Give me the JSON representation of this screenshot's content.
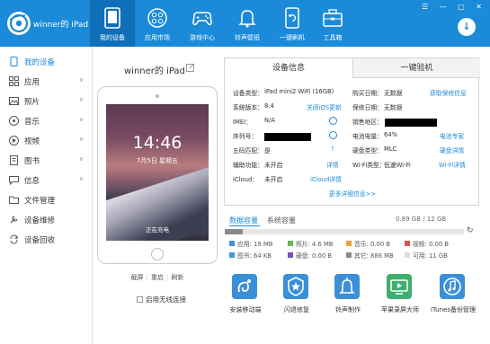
{
  "header": {
    "device_name": "winner的 iPad",
    "nav": [
      {
        "label": "我的设备",
        "icon": "tablet-icon",
        "active": true
      },
      {
        "label": "应用市场",
        "icon": "apps-grid-icon",
        "active": false
      },
      {
        "label": "游戏中心",
        "icon": "gamepad-icon",
        "active": false
      },
      {
        "label": "铃声壁纸",
        "icon": "bell-icon",
        "active": false
      },
      {
        "label": "一键刷机",
        "icon": "flash-phone-icon",
        "active": false
      },
      {
        "label": "工具箱",
        "icon": "toolbox-icon",
        "active": false
      }
    ],
    "window_controls": "☰ — □ ✕",
    "download_icon": "download-icon"
  },
  "sidebar": {
    "items": [
      {
        "label": "我的设备",
        "chevron": ""
      },
      {
        "label": "应用",
        "chevron": "∨"
      },
      {
        "label": "照片",
        "chevron": "∨"
      },
      {
        "label": "音乐",
        "chevron": "∨"
      },
      {
        "label": "视频",
        "chevron": "∨"
      },
      {
        "label": "图书",
        "chevron": "∨"
      },
      {
        "label": "信息",
        "chevron": "∨"
      },
      {
        "label": "文件管理",
        "chevron": ""
      },
      {
        "label": "设备维修",
        "chevron": ""
      },
      {
        "label": "设备回收",
        "chevron": ""
      }
    ]
  },
  "device": {
    "title": "winner的 iPad",
    "lock_time": "14:46",
    "lock_date": "7月5日 星期五",
    "charging": "正在充电",
    "actions": [
      "截屏",
      "重启",
      "刷新"
    ],
    "wireless_label": "启用无线连接"
  },
  "info": {
    "tab_active": "设备信息",
    "tab_other": "一键验机",
    "rows": [
      {
        "l1": "设备类型：",
        "v1": "iPad mini2 WiFi  (16GB)",
        "a1": "",
        "l2": "购买日期：",
        "v2": "无数据",
        "a2": "获取保修信息"
      },
      {
        "l1": "系统版本：",
        "v1": "8.4",
        "a1": "关闭iOS更新",
        "l2": "保修日期：",
        "v2": "无数据",
        "a2": ""
      },
      {
        "l1": "IMEI：",
        "v1": "N/A",
        "a1": "",
        "l2": "销售地区：",
        "v2": "",
        "a2": ""
      },
      {
        "l1": "序列号：",
        "v1": "",
        "a1": "",
        "l2": "电池电量：",
        "v2": "64%",
        "a2": "电池专家"
      },
      {
        "l1": "五码匹配：",
        "v1": "是",
        "a1": "?",
        "l2": "硬盘类型：",
        "v2": "MLC",
        "a2": "硬盘详情"
      },
      {
        "l1": "辅助功能：",
        "v1": "未开启",
        "a1": "详情",
        "l2": "Wi-Fi类型：",
        "v2": "低速Wi-Fi",
        "a2": "Wi-Fi详情"
      },
      {
        "l1": "iCloud：",
        "v1": "未开启",
        "a1": "iCloud详情",
        "l2": "",
        "v2": "",
        "a2": ""
      }
    ],
    "more_link": "更多详细信息>>"
  },
  "storage": {
    "tab_active": "数据容量",
    "tab_other": "系统容量",
    "total": "0.89 GB / 12 GB",
    "used_fraction": 0.074,
    "legend": [
      {
        "label": "应用: 19 MB",
        "color": "#4a90d9"
      },
      {
        "label": "照片: 4.6 MB",
        "color": "#5cb85c"
      },
      {
        "label": "音乐: 0.00 B",
        "color": "#e8a33d"
      },
      {
        "label": "视频: 0.00 B",
        "color": "#d9534f"
      },
      {
        "label": "图书: 64 KB",
        "color": "#3b9ad8"
      },
      {
        "label": "硬盘: 0.00 B",
        "color": "#7b4fbf"
      },
      {
        "label": "其它: 886 MB",
        "color": "#888888"
      },
      {
        "label": "可用: 11 GB",
        "color": "#dddddd"
      }
    ]
  },
  "tools": [
    {
      "label": "安装移动端",
      "icon": "mobile-app-icon",
      "color": "#3b8fd8"
    },
    {
      "label": "闪退修复",
      "icon": "badge-star-icon",
      "color": "#3b8fd8"
    },
    {
      "label": "铃声制作",
      "icon": "bell-maker-icon",
      "color": "#3b8fd8"
    },
    {
      "label": "苹果录屏大师",
      "icon": "screen-record-icon",
      "color": "#3fae6f"
    },
    {
      "label": "iTunes备份管理",
      "icon": "music-note-icon",
      "color": "#3b8fd8"
    }
  ]
}
